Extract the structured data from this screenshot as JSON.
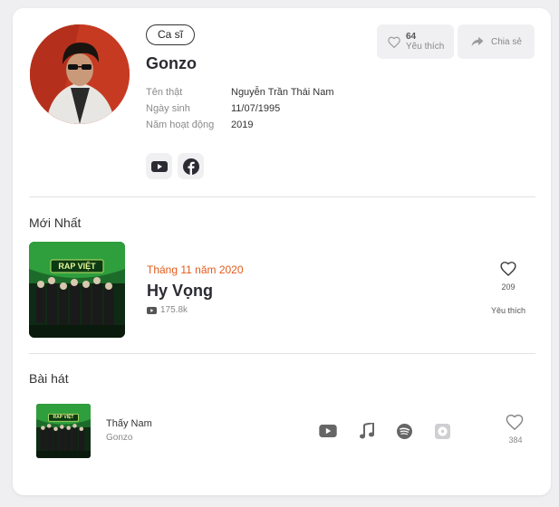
{
  "artist": {
    "role_badge": "Ca sĩ",
    "name": "Gonzo",
    "info": [
      {
        "label": "Tên thật",
        "value": "Nguyễn Trần Thái Nam"
      },
      {
        "label": "Ngày sinh",
        "value": "11/07/1995"
      },
      {
        "label": "Năm hoạt động",
        "value": "2019"
      }
    ],
    "socials": [
      "youtube-icon",
      "facebook-icon"
    ]
  },
  "actions": {
    "like_count": "64",
    "like_label": "Yêu thích",
    "share_label": "Chia sẻ"
  },
  "latest": {
    "section_title": "Mới Nhất",
    "cover_text": "RAP VIỆT",
    "date": "Tháng 11 năm 2020",
    "title": "Hy Vọng",
    "views": "175.8k",
    "like_count": "209",
    "like_label": "Yêu thích"
  },
  "songs": {
    "section_title": "Bài hát",
    "items": [
      {
        "title": "Thấy Nam",
        "artist": "Gonzo",
        "cover_text": "RAP VIỆT",
        "platforms": [
          "youtube-icon",
          "music-note-icon",
          "spotify-icon",
          "cd-icon"
        ],
        "like_count": "384"
      }
    ]
  },
  "colors": {
    "accent_date": "#e55a1a",
    "background": "#efeff1",
    "card": "#ffffff"
  }
}
